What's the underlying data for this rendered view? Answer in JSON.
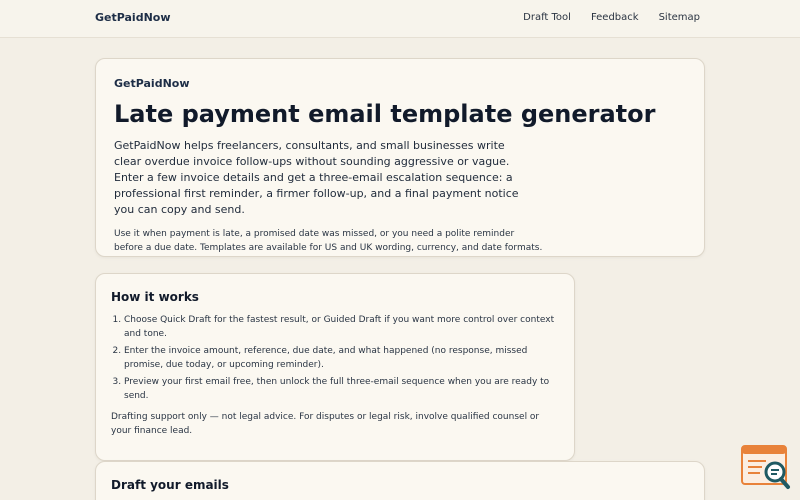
{
  "header": {
    "brand": "GetPaidNow",
    "nav": [
      {
        "label": "Draft Tool"
      },
      {
        "label": "Feedback"
      },
      {
        "label": "Sitemap"
      }
    ]
  },
  "hero": {
    "eyebrow": "GetPaidNow",
    "title": "Late payment email template generator",
    "lead": "GetPaidNow helps freelancers, consultants, and small businesses write clear overdue invoice follow-ups without sounding aggressive or vague. Enter a few invoice details and get a three-email escalation sequence: a professional first reminder, a firmer follow-up, and a final payment notice you can copy and send.",
    "sub": "Use it when payment is late, a promised date was missed, or you need a polite reminder before a due date. Templates are available for US and UK wording, currency, and date formats."
  },
  "how_it_works": {
    "title": "How it works",
    "steps": [
      "Choose Quick Draft for the fastest result, or Guided Draft if you want more control over context and tone.",
      "Enter the invoice amount, reference, due date, and what happened (no response, missed promise, due today, or upcoming reminder).",
      "Preview your first email free, then unlock the full three-email sequence when you are ready to send."
    ],
    "note": "Drafting support only — not legal advice. For disputes or legal risk, involve qualified counsel or your finance lead."
  },
  "draft": {
    "title": "Draft your emails"
  },
  "colors": {
    "background": "#f3efe6",
    "card": "#fbf8f1",
    "brand_navy": "#1d2d46",
    "fab_orange": "#e8823a",
    "fab_teal": "#1f5a63"
  },
  "icons": {
    "floating_widget": "document-search-icon"
  }
}
